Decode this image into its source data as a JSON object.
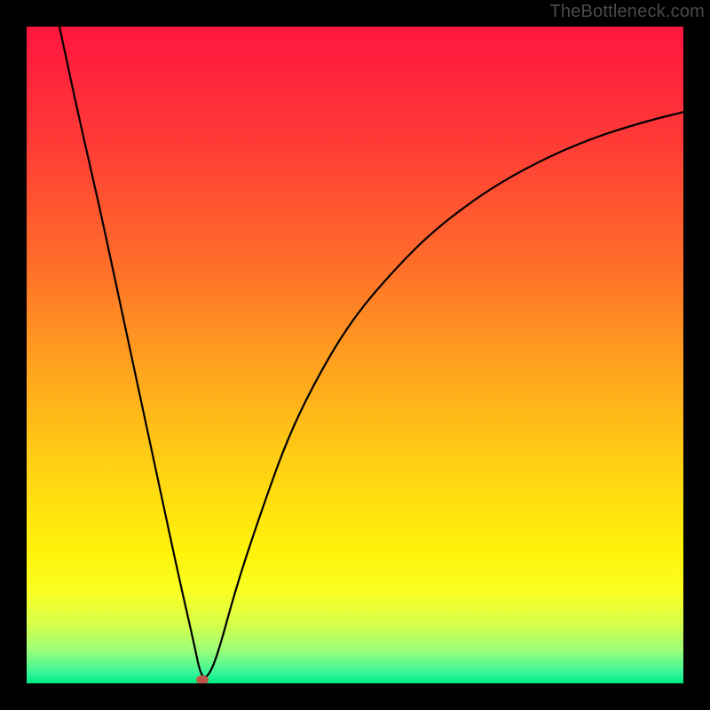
{
  "watermark": "TheBottleneck.com",
  "chart_data": {
    "type": "line",
    "title": "",
    "xlabel": "",
    "ylabel": "",
    "xlim": [
      0,
      100
    ],
    "ylim": [
      0,
      100
    ],
    "grid": false,
    "legend": false,
    "background_gradient": {
      "orientation": "vertical",
      "stops": [
        {
          "pos": 0.0,
          "color": "#ff153f"
        },
        {
          "pos": 0.18,
          "color": "#ff3c36"
        },
        {
          "pos": 0.36,
          "color": "#ff6d2a"
        },
        {
          "pos": 0.52,
          "color": "#ffa31e"
        },
        {
          "pos": 0.68,
          "color": "#ffd412"
        },
        {
          "pos": 0.8,
          "color": "#fff30a"
        },
        {
          "pos": 0.86,
          "color": "#f9ff22"
        },
        {
          "pos": 0.91,
          "color": "#d6ff4a"
        },
        {
          "pos": 0.95,
          "color": "#9aff78"
        },
        {
          "pos": 0.985,
          "color": "#34f59a"
        },
        {
          "pos": 1.0,
          "color": "#00e881"
        }
      ]
    },
    "series": [
      {
        "name": "bottleneck-curve",
        "color": "#000000",
        "x": [
          5,
          8,
          11,
          14,
          17,
          20,
          23,
          25.5,
          26.5,
          27.5,
          29,
          32,
          36,
          40,
          45,
          50,
          56,
          62,
          70,
          78,
          86,
          94,
          100
        ],
        "y": [
          100,
          86,
          73,
          59,
          45,
          31,
          17,
          6,
          1.2,
          0.8,
          4,
          15,
          27,
          38,
          48,
          56,
          63,
          69,
          75,
          79.5,
          83,
          85.5,
          87
        ]
      }
    ],
    "marker": {
      "name": "min-bottleneck-point",
      "x": 26.8,
      "y": 0.6,
      "color": "#c1534b"
    }
  }
}
